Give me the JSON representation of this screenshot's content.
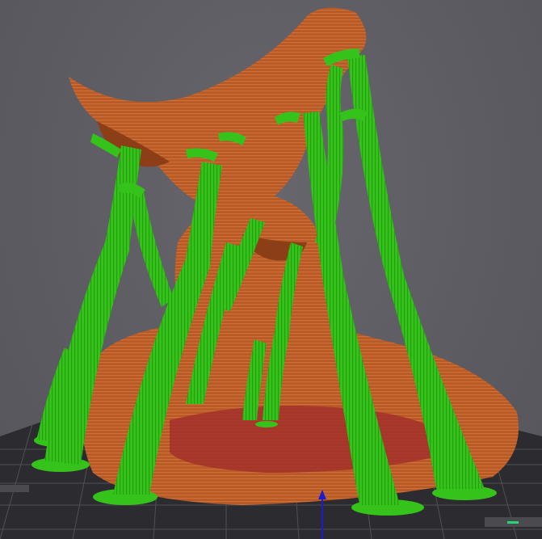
{
  "app": {
    "view": "3D preview",
    "bed_label": ""
  },
  "colors": {
    "background": "#5d5d63",
    "bed": "#2c2c30",
    "bed_grid": "#5a5a5f",
    "model": "#b75a26",
    "model_shadow": "#8c3e16",
    "model_inner": "#a3302a",
    "support": "#35c21b",
    "support_dark": "#1f8f0c",
    "axis_z": "#1b1bd0",
    "axis_green": "#29d47a"
  },
  "icons": {
    "axis": "z-axis-arrow-icon"
  }
}
